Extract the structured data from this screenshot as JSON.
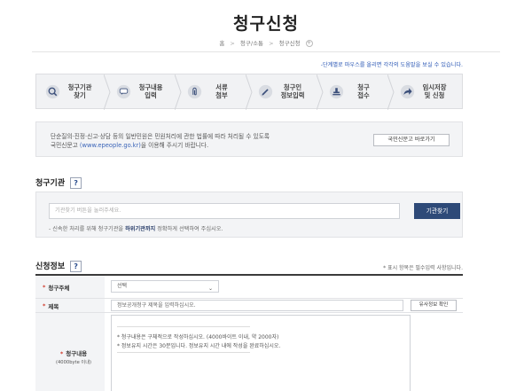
{
  "page": {
    "title": "청구신청",
    "breadcrumb": [
      "홈",
      "청구/소통",
      "청구신청"
    ],
    "breadcrumb_separator": ">",
    "breadcrumb_plus": "+"
  },
  "step_notice": "-단계별로 마우스를 올리면 각각의 도움말을 보실 수 있습니다.",
  "steps": [
    {
      "line1": "청구기관",
      "line2": "찾기",
      "icon": "search-icon"
    },
    {
      "line1": "청구내용",
      "line2": "입력",
      "icon": "speech-bubble-icon"
    },
    {
      "line1": "서류",
      "line2": "첨부",
      "icon": "paperclip-icon"
    },
    {
      "line1": "청구인",
      "line2": "정보입력",
      "icon": "pencil-icon"
    },
    {
      "line1": "청구",
      "line2": "접수",
      "icon": "stamp-icon"
    },
    {
      "line1": "임시저장",
      "line2": "및 신청",
      "icon": "share-arrow-icon"
    }
  ],
  "external": {
    "line1": "단순질의·진정·신고·상담 등의 일반민원은 민원처리에 관한 법률에 따라 처리될 수 있도록",
    "line2_pre": "국민신문고 ",
    "line2_link": "(www.epeople.go.kr)",
    "line2_post": "을 이용해 주시기 바랍니다.",
    "button": "국민신문고 바로가기"
  },
  "org_section": {
    "title": "청구기관",
    "help": "?",
    "placeholder": "기관찾기 버튼을 눌러주세요.",
    "button": "기관찾기",
    "note_pre": "- 신속한 처리를 위해 청구기관을 ",
    "note_bold": "하위기관까지",
    "note_post": " 정확하게 선택하여 주십시오."
  },
  "apply_section": {
    "title": "신청정보",
    "help": "?",
    "required_note": "* 표시 항목은 필수입력 사항입니다.",
    "fields": {
      "subject": {
        "star": "*",
        "label": "청구주체",
        "value": "선택",
        "arrow": "⌄"
      },
      "title": {
        "star": "*",
        "label": "제목",
        "placeholder": "정보공개청구 제목을 입력하십시오.",
        "button": "유사정보 확인"
      },
      "content": {
        "star": "*",
        "label": "청구내용",
        "sub_label": "(4000byte 이내)",
        "hints": [
          "* 청구내용은 구체적으로 작성하십시오. (4000바이트 이내, 약 2000자)",
          "* 정보유지 시간은 30분입니다. 정보유지 시간 내에 작성을 완료하십시오."
        ]
      }
    }
  },
  "colors": {
    "accent_navy": "#2e4a78",
    "link_blue": "#2b57b5",
    "required_red": "#d03a2b"
  }
}
